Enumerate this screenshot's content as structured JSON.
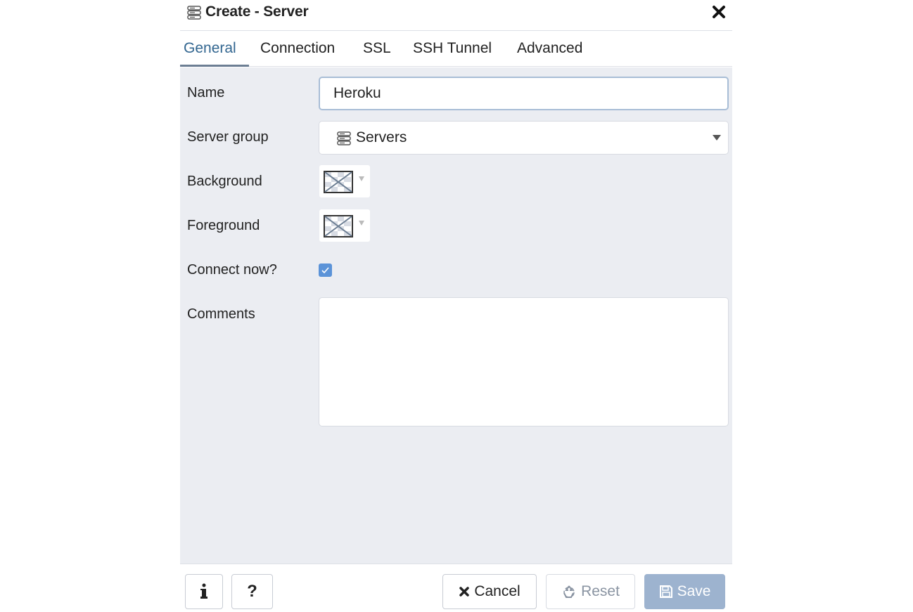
{
  "dialog": {
    "title": "Create - Server",
    "title_icon": "server-group-icon",
    "close_icon": "close-icon"
  },
  "tabs": [
    {
      "label": "General",
      "active": true
    },
    {
      "label": "Connection",
      "active": false
    },
    {
      "label": "SSL",
      "active": false
    },
    {
      "label": "SSH Tunnel",
      "active": false
    },
    {
      "label": "Advanced",
      "active": false
    }
  ],
  "form": {
    "name": {
      "label": "Name",
      "value": "Heroku"
    },
    "server_group": {
      "label": "Server group",
      "value": "Servers",
      "icon": "server-group-icon"
    },
    "background": {
      "label": "Background"
    },
    "foreground": {
      "label": "Foreground"
    },
    "connect_now": {
      "label": "Connect now?",
      "checked": true
    },
    "comments": {
      "label": "Comments",
      "value": ""
    }
  },
  "footer": {
    "info_icon": "info-icon",
    "help_label": "?",
    "cancel_label": "Cancel",
    "reset_label": "Reset",
    "save_label": "Save"
  },
  "colors": {
    "accent": "#326690",
    "checkbox": "#5b93d8",
    "body_bg": "#ebedf2",
    "save_bg": "#9db3cf"
  }
}
